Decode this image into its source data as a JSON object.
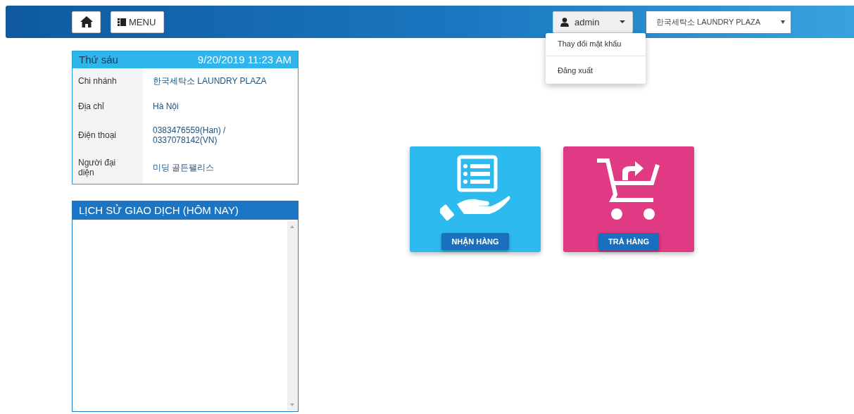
{
  "header": {
    "menu_label": "MENU",
    "user": {
      "name": "admin",
      "expanded": true
    },
    "branch_select": {
      "value": "한국세탁소 LAUNDRY PLAZA"
    },
    "user_menu": [
      "Thay đổi mật khẩu",
      "Đăng xuất"
    ]
  },
  "info_card": {
    "day": "Thứ sáu",
    "datetime": "9/20/2019 11:23 AM",
    "rows": [
      {
        "label": "Chi nhánh",
        "value": "한국세탁소 LAUNDRY PLAZA"
      },
      {
        "label": "Địa chỉ",
        "value": "Hà Nội"
      },
      {
        "label": "Điện thoại",
        "value": "0383476559(Han) / 0337078142(VN)"
      },
      {
        "label": "Người đại diện",
        "value": "미딩 골든팰리스"
      }
    ]
  },
  "history": {
    "title": "LỊCH SỬ GIAO DỊCH (HÔM NAY)"
  },
  "tiles": [
    {
      "kind": "receive",
      "label": "NHẬN HÀNG",
      "color": "#2dbaef"
    },
    {
      "kind": "return",
      "label": "TRẢ HÀNG",
      "color": "#e03a84"
    }
  ]
}
